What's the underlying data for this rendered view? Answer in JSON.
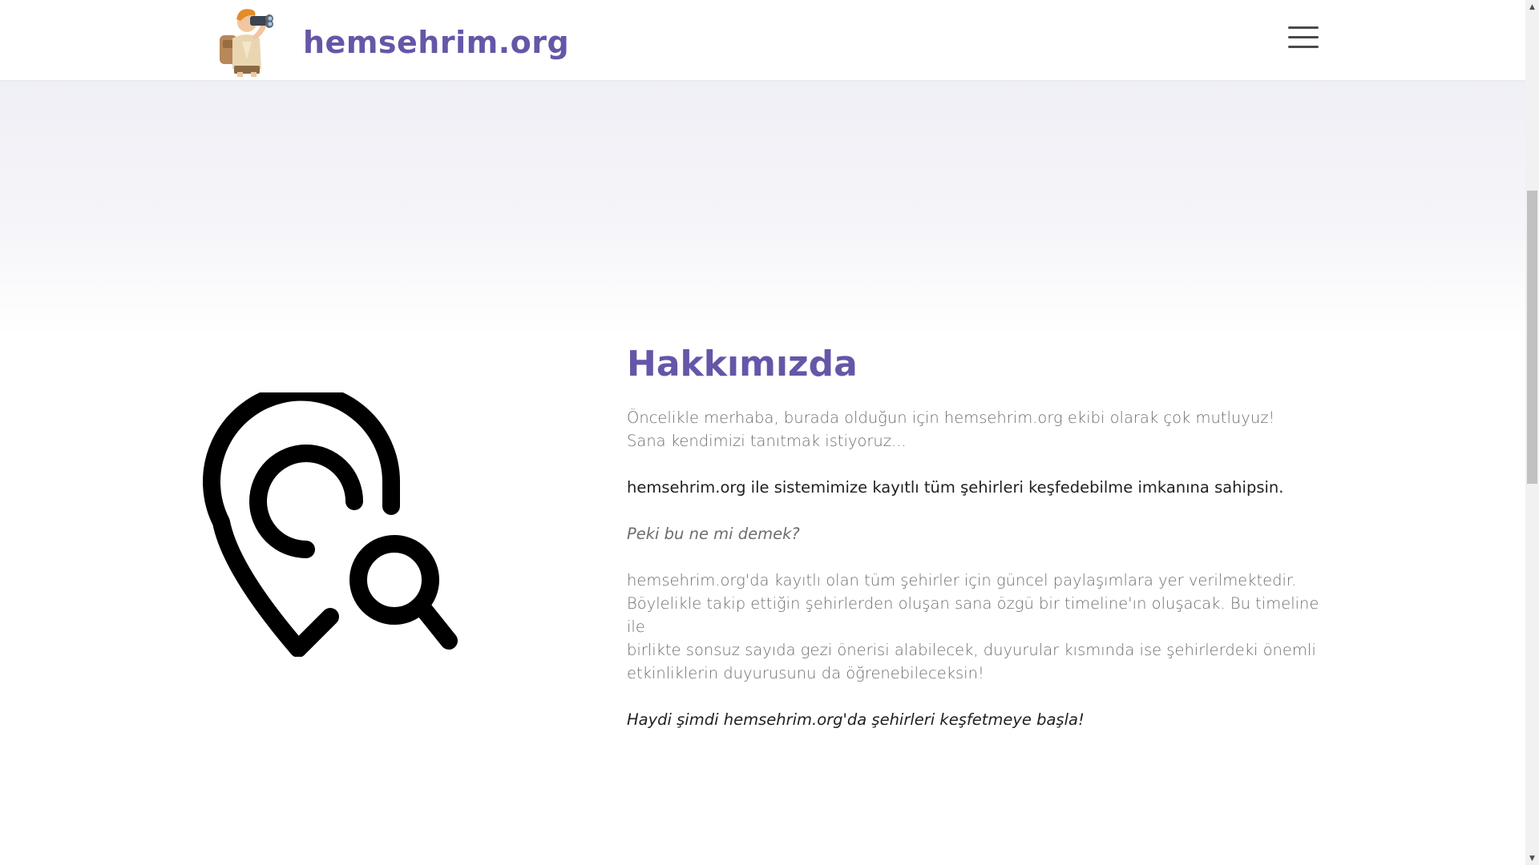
{
  "header": {
    "brand": "hemsehrim.org",
    "logo_icon": "explorer-with-binoculars",
    "menu_icon": "hamburger-menu-icon"
  },
  "about": {
    "title": "Hakkımızda",
    "illustration_icon": "location-search-icon",
    "intro_line1": "Öncelikle merhaba, burada olduğun için hemsehrim.org ekibi olarak çok mutluyuz!",
    "intro_line2": "Sana kendimizi tanıtmak istiyoruz...",
    "highlight": "hemsehrim.org ile sistemimize kayıtlı tüm şehirleri keşfedebilme imkanına sahipsin.",
    "question": "Peki bu ne mi demek?",
    "details_line1": "hemsehrim.org'da kayıtlı olan tüm şehirler için güncel paylaşımlara yer verilmektedir.",
    "details_line2": "Böylelikle takip ettiğin şehirlerden oluşan sana özgü bir timeline'ın oluşacak. Bu timeline ile",
    "details_line3": "birlikte sonsuz sayıda gezi önerisi alabilecek, duyurular kısmında ise şehirlerdeki önemli",
    "details_line4": "etkinliklerin duyurusunu da öğrenebileceksin!",
    "cta": "Haydi şimdi hemsehrim.org'da şehirleri keşfetmeye başla!"
  },
  "colors": {
    "brand": "#6656a8",
    "text_muted": "#6d6d6d",
    "text_dark": "#222222"
  }
}
